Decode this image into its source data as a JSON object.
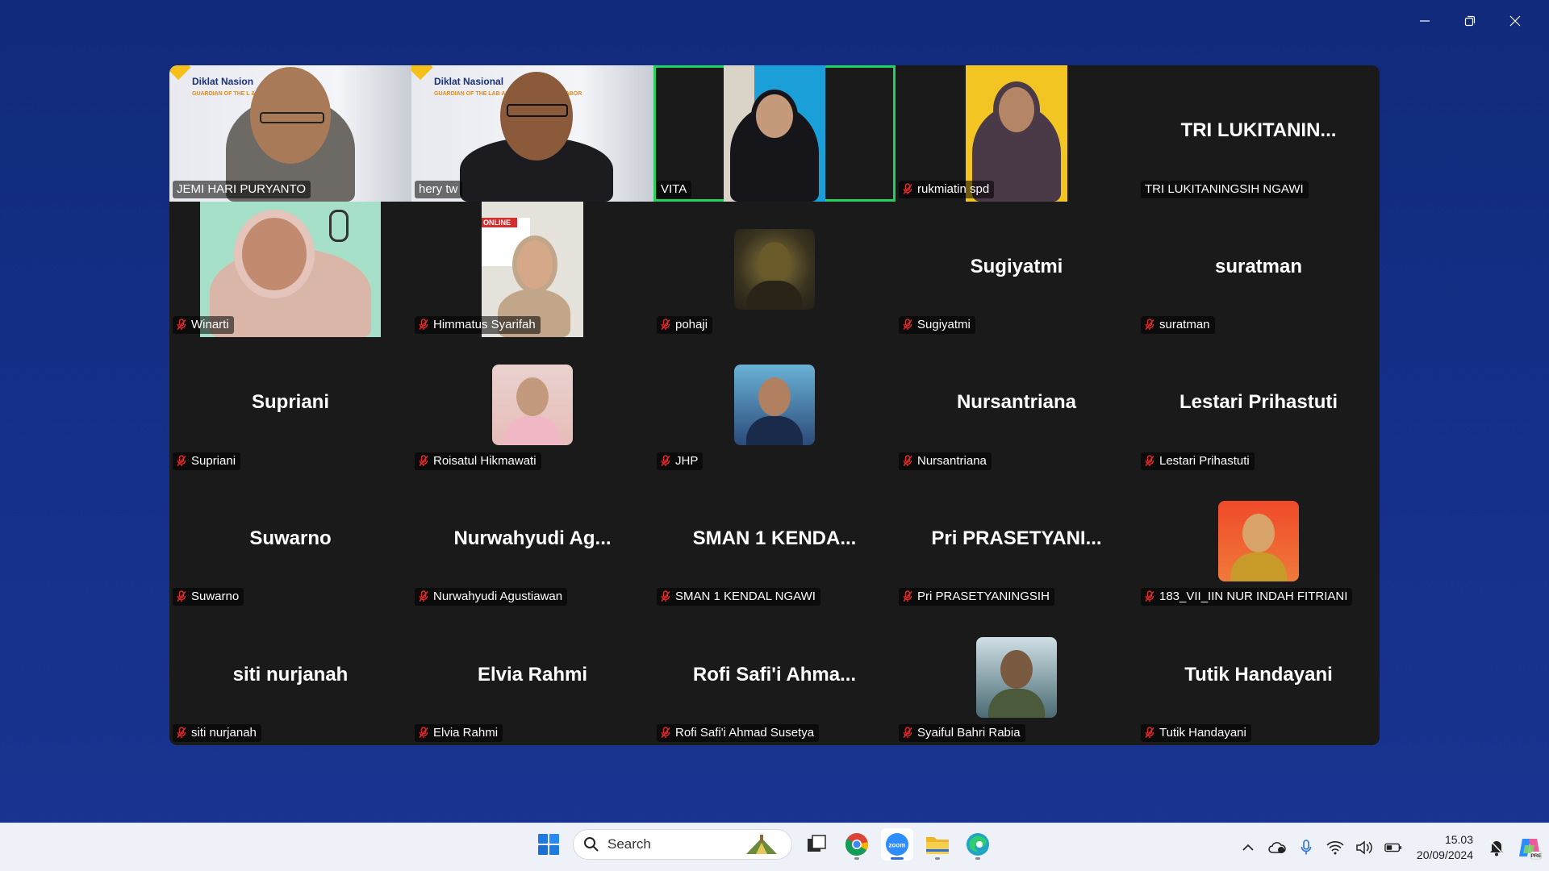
{
  "window": {
    "minimize_icon": "minimize-icon",
    "restore_icon": "restore-icon",
    "close_icon": "close-icon"
  },
  "gallery": {
    "tiles": [
      {
        "name": "JEMI HARI PURYANTO",
        "muted": false,
        "video": true,
        "banner_title": "Diklat Nasion",
        "banner_sub": "GUARDIAN OF THE L & ANALISIS CP KOLAB"
      },
      {
        "name": "hery tw",
        "muted": false,
        "video": true,
        "banner_title": "Diklat Nasional",
        "banner_sub": "GUARDIAN OF THE LAB AS & ANALISIS CP KOLABOR"
      },
      {
        "name": "VITA",
        "muted": false,
        "video": true,
        "active": true
      },
      {
        "name": "rukmiatin spd",
        "muted": true,
        "video": true
      },
      {
        "name": "TRI LUKITANINGSIH NGAWI",
        "big": "TRI  LUKITANIN...",
        "muted": false
      },
      {
        "name": "Winarti",
        "muted": true,
        "video": true
      },
      {
        "name": "Himmatus Syarifah",
        "muted": true,
        "video": true,
        "banner_sub": "ONLINE"
      },
      {
        "name": "pohaji",
        "muted": true,
        "avatar": true
      },
      {
        "name": "Sugiyatmi",
        "big": "Sugiyatmi",
        "muted": true
      },
      {
        "name": "suratman",
        "big": "suratman",
        "muted": true
      },
      {
        "name": "Supriani",
        "big": "Supriani",
        "muted": true
      },
      {
        "name": "Roisatul Hikmawati",
        "muted": true,
        "avatar": true
      },
      {
        "name": "JHP",
        "muted": true,
        "avatar": true
      },
      {
        "name": "Nursantriana",
        "big": "Nursantriana",
        "muted": true
      },
      {
        "name": "Lestari Prihastuti",
        "big": "Lestari Prihastuti",
        "muted": true
      },
      {
        "name": "Suwarno",
        "big": "Suwarno",
        "muted": true
      },
      {
        "name": "Nurwahyudi Agustiawan",
        "big": "Nurwahyudi  Ag...",
        "muted": true
      },
      {
        "name": "SMAN 1 KENDAL NGAWI",
        "big": "SMAN  1  KENDA...",
        "muted": true
      },
      {
        "name": "Pri PRASETYANINGSIH",
        "big": "Pri  PRASETYANI...",
        "muted": true
      },
      {
        "name": "183_VII_IIN NUR INDAH FITRIANI",
        "muted": true,
        "avatar": true
      },
      {
        "name": "siti nurjanah",
        "big": "siti nurjanah",
        "muted": true
      },
      {
        "name": "Elvia Rahmi",
        "big": "Elvia Rahmi",
        "muted": true
      },
      {
        "name": "Rofi Safi'i Ahmad Susetya",
        "big": "Rofi Safi'i Ahma...",
        "muted": true
      },
      {
        "name": "Syaiful Bahri Rabia",
        "muted": true,
        "avatar": true
      },
      {
        "name": "Tutik Handayani",
        "big": "Tutik Handayani",
        "muted": true
      }
    ]
  },
  "taskbar": {
    "search_placeholder": "Search",
    "apps": [
      "windows-start-icon",
      "task-view-icon",
      "chrome-icon",
      "zoom-icon",
      "file-explorer-icon",
      "edge-icon"
    ],
    "clock_time": "15.03",
    "clock_date": "20/09/2024",
    "tray": [
      "chevron-up-icon",
      "cloud-icon",
      "microphone-icon",
      "wifi-icon",
      "volume-icon",
      "battery-icon",
      "notification-icon",
      "copilot-icon"
    ],
    "accent": "#2b6fd8"
  },
  "colors": {
    "background": "#15308a",
    "gallery_bg": "#1a1a1a",
    "active_speaker": "#23d160",
    "muted_mic": "#e02828"
  }
}
